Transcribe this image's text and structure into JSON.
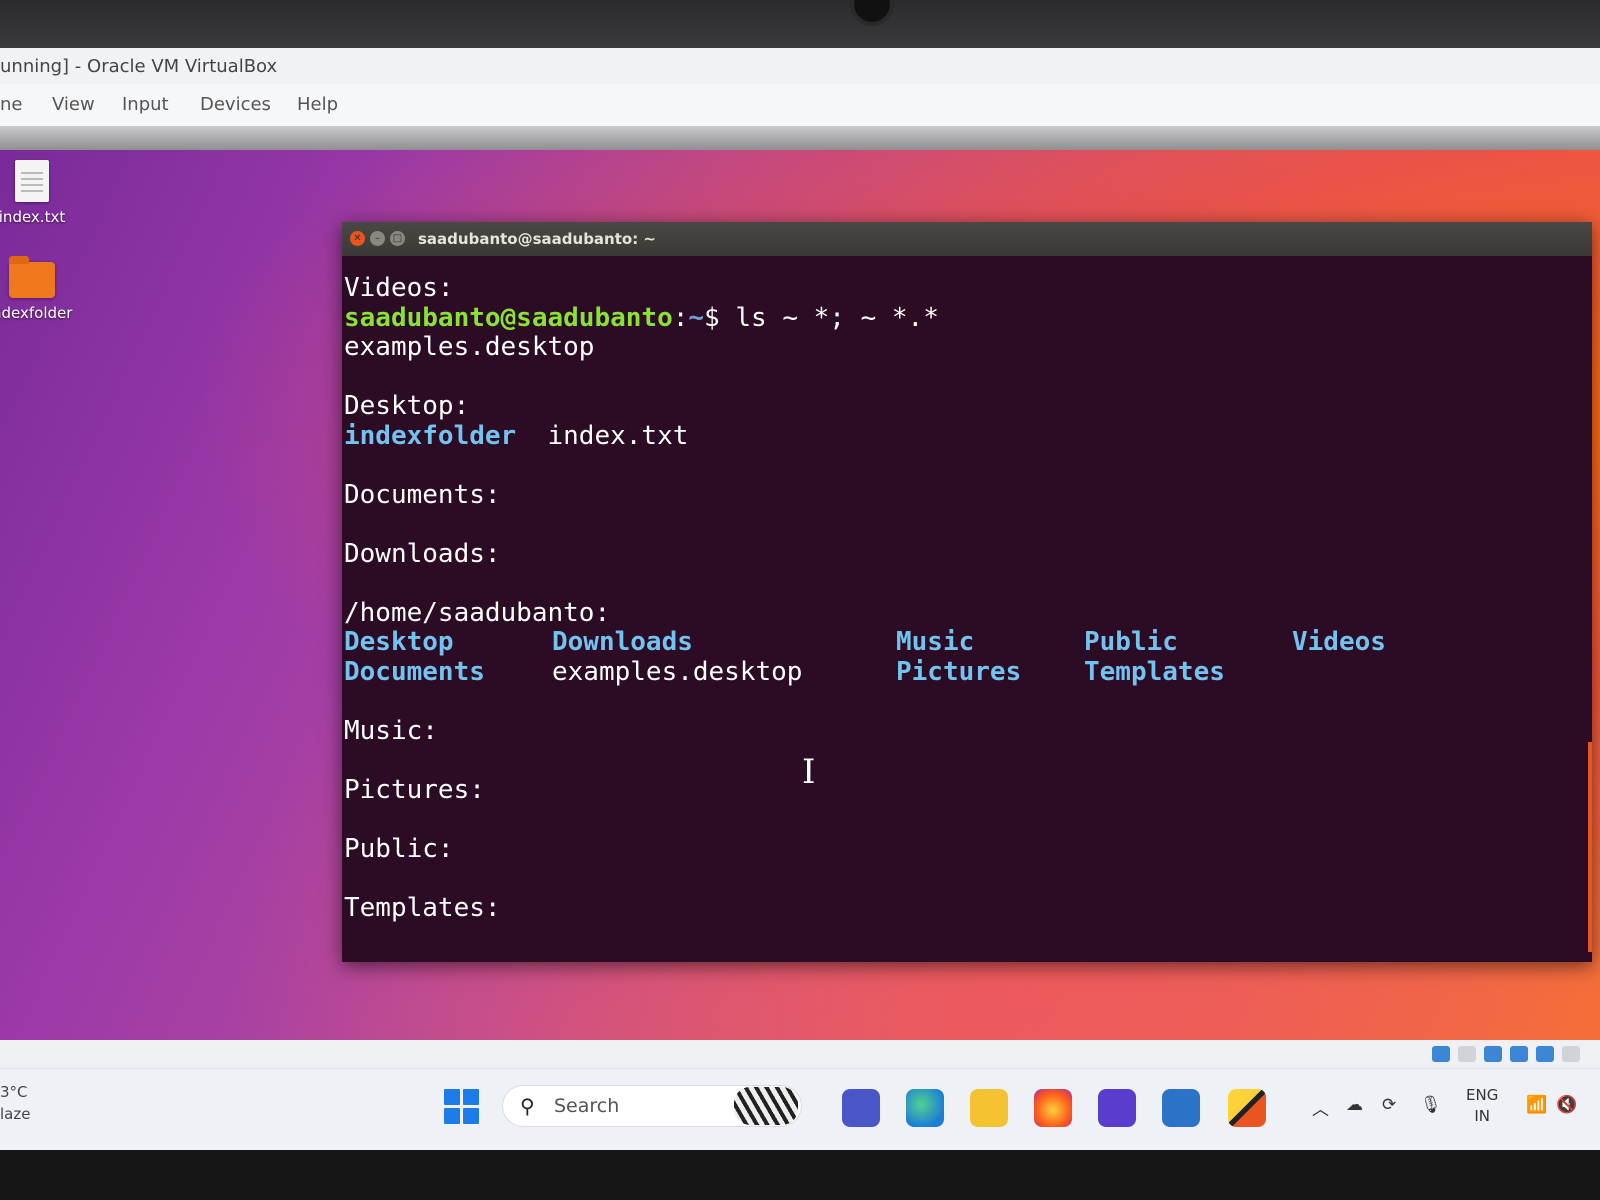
{
  "vbox": {
    "title": "unning] - Oracle VM VirtualBox",
    "menu": [
      "ne",
      "View",
      "Input",
      "Devices",
      "Help"
    ]
  },
  "desktop": {
    "icons": [
      {
        "label": "index.txt",
        "icon": "text-file-icon"
      },
      {
        "label": "ndexfolder",
        "icon": "folder-icon"
      }
    ]
  },
  "terminal": {
    "title": "saadubanto@saadubanto: ~",
    "lines": {
      "videos_header": "Videos:",
      "prompt_user": "saadubanto@saadubanto",
      "prompt_colon": ":",
      "prompt_path": "~",
      "prompt_command": "$ ls ~ *; ~ *.*",
      "examples": "examples.desktop",
      "desktop_header": "Desktop:",
      "desktop_dir": "indexfolder",
      "desktop_file": "index.txt",
      "documents_header": "Documents:",
      "downloads_header": "Downloads:",
      "home_header": "/home/saadubanto:",
      "home_row1": [
        "Desktop",
        "Downloads",
        "Music",
        "Public",
        "Videos"
      ],
      "home_row2": [
        "Documents",
        "examples.desktop",
        "Pictures",
        "Templates"
      ],
      "music_header": "Music:",
      "pictures_header": "Pictures:",
      "public_header": "Public:",
      "templates_header": "Templates:"
    },
    "colors": {
      "background": "#2c0b24",
      "user": "#8ae234",
      "path": "#729fcf",
      "directory": "#73c3f0",
      "text": "#ffffff"
    }
  },
  "taskbar": {
    "weather_temp": "3°C",
    "weather_desc": "laze",
    "search_placeholder": "Search",
    "apps": [
      "teams-icon",
      "edge-icon",
      "file-explorer-icon",
      "firefox-icon",
      "copilot-icon",
      "virtualbox-icon",
      "ubuntu-vm-icon"
    ],
    "language_top": "ENG",
    "language_bottom": "IN"
  }
}
